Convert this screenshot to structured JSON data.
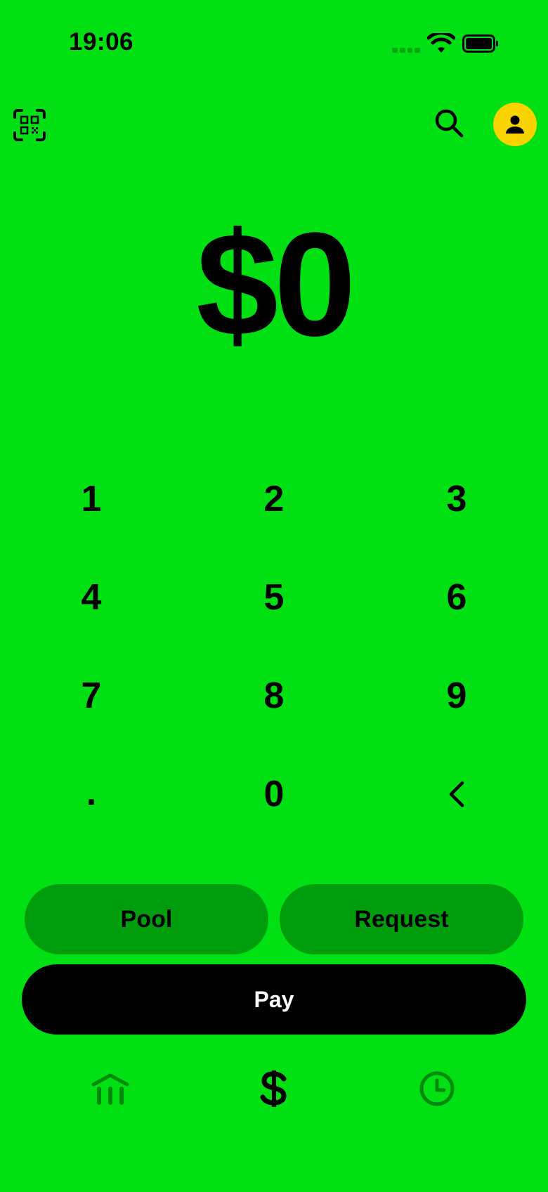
{
  "status_bar": {
    "time": "19:06"
  },
  "amount": {
    "value": "$0"
  },
  "keypad": {
    "keys": [
      "1",
      "2",
      "3",
      "4",
      "5",
      "6",
      "7",
      "8",
      "9",
      ".",
      "0",
      "<"
    ]
  },
  "actions": {
    "pool_label": "Pool",
    "request_label": "Request",
    "pay_label": "Pay"
  },
  "icons": {
    "qr": "qr-scan-icon",
    "search": "search-icon",
    "profile": "profile-icon",
    "banking": "bank-icon",
    "pay": "dollar-icon",
    "activity": "clock-icon"
  },
  "colors": {
    "background": "#00E013",
    "pill": "#009E0C",
    "avatar": "#F8D300",
    "nav_inactive": "#008A0B",
    "pay_button": "#000000"
  }
}
